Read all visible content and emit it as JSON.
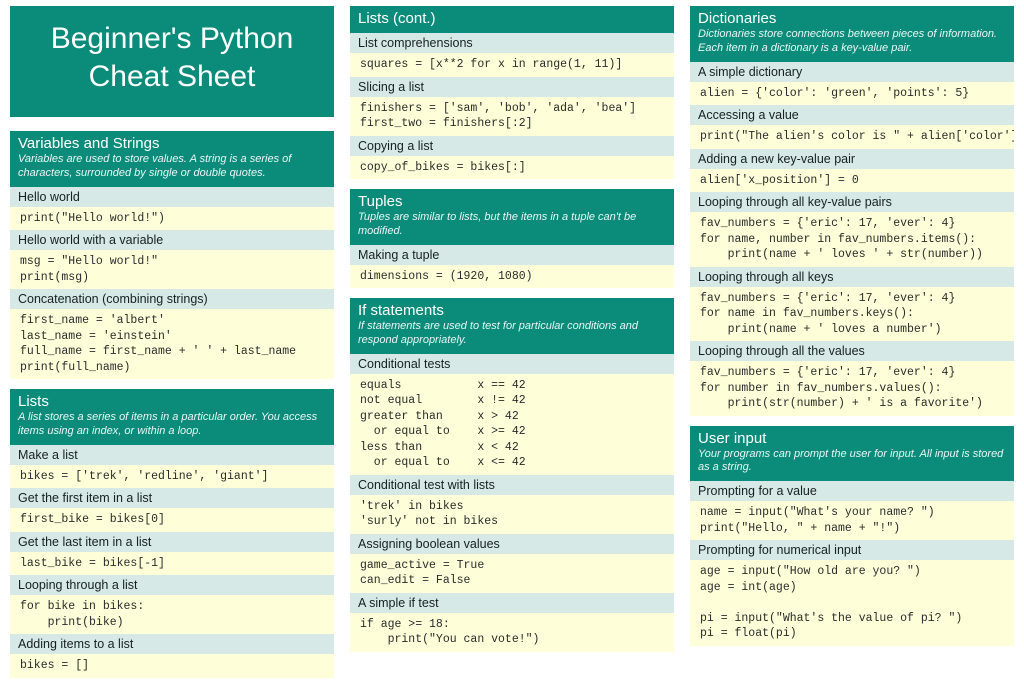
{
  "title": "Beginner's Python\nCheat Sheet",
  "columns": [
    [
      {
        "type": "title"
      },
      {
        "type": "head",
        "h": "Variables and Strings",
        "desc": "Variables are used to store values. A string is a series of characters, surrounded by single or double quotes."
      },
      {
        "type": "sub",
        "t": "Hello world"
      },
      {
        "type": "code",
        "t": "print(\"Hello world!\")"
      },
      {
        "type": "sub",
        "t": "Hello world with a variable"
      },
      {
        "type": "code",
        "t": "msg = \"Hello world!\"\nprint(msg)"
      },
      {
        "type": "sub",
        "t": "Concatenation (combining strings)"
      },
      {
        "type": "code",
        "t": "first_name = 'albert'\nlast_name = 'einstein'\nfull_name = first_name + ' ' + last_name\nprint(full_name)"
      },
      {
        "type": "head",
        "h": "Lists",
        "desc": "A list stores a series of items in a particular order. You access items using an index, or within a loop."
      },
      {
        "type": "sub",
        "t": "Make a list"
      },
      {
        "type": "code",
        "t": "bikes = ['trek', 'redline', 'giant']"
      },
      {
        "type": "sub",
        "t": "Get the first item in a list"
      },
      {
        "type": "code",
        "t": "first_bike = bikes[0]"
      },
      {
        "type": "sub",
        "t": "Get the last item in a list"
      },
      {
        "type": "code",
        "t": "last_bike = bikes[-1]"
      },
      {
        "type": "sub",
        "t": "Looping through a list"
      },
      {
        "type": "code",
        "t": "for bike in bikes:\n    print(bike)"
      },
      {
        "type": "sub",
        "t": "Adding items to a list"
      },
      {
        "type": "code",
        "t": "bikes = []"
      }
    ],
    [
      {
        "type": "head",
        "first": true,
        "h": "Lists (cont.)"
      },
      {
        "type": "sub",
        "t": "List comprehensions"
      },
      {
        "type": "code",
        "t": "squares = [x**2 for x in range(1, 11)]"
      },
      {
        "type": "sub",
        "t": "Slicing a list"
      },
      {
        "type": "code",
        "t": "finishers = ['sam', 'bob', 'ada', 'bea']\nfirst_two = finishers[:2]"
      },
      {
        "type": "sub",
        "t": "Copying a list"
      },
      {
        "type": "code",
        "t": "copy_of_bikes = bikes[:]"
      },
      {
        "type": "head",
        "h": "Tuples",
        "desc": "Tuples are similar to lists, but the items in a tuple can't be modified."
      },
      {
        "type": "sub",
        "t": "Making a tuple"
      },
      {
        "type": "code",
        "t": "dimensions = (1920, 1080)"
      },
      {
        "type": "head",
        "h": "If statements",
        "desc": "If statements are used to test for particular conditions and respond appropriately."
      },
      {
        "type": "sub",
        "t": "Conditional tests"
      },
      {
        "type": "code",
        "t": "equals           x == 42\nnot equal        x != 42\ngreater than     x > 42\n  or equal to    x >= 42\nless than        x < 42\n  or equal to    x <= 42"
      },
      {
        "type": "sub",
        "t": "Conditional test with lists"
      },
      {
        "type": "code",
        "t": "'trek' in bikes\n'surly' not in bikes"
      },
      {
        "type": "sub",
        "t": "Assigning boolean values"
      },
      {
        "type": "code",
        "t": "game_active = True\ncan_edit = False"
      },
      {
        "type": "sub",
        "t": "A simple if test"
      },
      {
        "type": "code",
        "t": "if age >= 18:\n    print(\"You can vote!\")"
      }
    ],
    [
      {
        "type": "head",
        "first": true,
        "h": "Dictionaries",
        "desc": "Dictionaries store connections between pieces of information. Each item in a dictionary is a key-value pair."
      },
      {
        "type": "sub",
        "t": "A simple dictionary"
      },
      {
        "type": "code",
        "t": "alien = {'color': 'green', 'points': 5}"
      },
      {
        "type": "sub",
        "t": "Accessing a value"
      },
      {
        "type": "code",
        "t": "print(\"The alien's color is \" + alien['color'])"
      },
      {
        "type": "sub",
        "t": "Adding a new key-value pair"
      },
      {
        "type": "code",
        "t": "alien['x_position'] = 0"
      },
      {
        "type": "sub",
        "t": "Looping through all key-value pairs"
      },
      {
        "type": "code",
        "t": "fav_numbers = {'eric': 17, 'ever': 4}\nfor name, number in fav_numbers.items():\n    print(name + ' loves ' + str(number))"
      },
      {
        "type": "sub",
        "t": "Looping through all keys"
      },
      {
        "type": "code",
        "t": "fav_numbers = {'eric': 17, 'ever': 4}\nfor name in fav_numbers.keys():\n    print(name + ' loves a number')"
      },
      {
        "type": "sub",
        "t": "Looping through all the values"
      },
      {
        "type": "code",
        "t": "fav_numbers = {'eric': 17, 'ever': 4}\nfor number in fav_numbers.values():\n    print(str(number) + ' is a favorite')"
      },
      {
        "type": "head",
        "h": "User input",
        "desc": "Your programs can prompt the user for input. All input is stored as a string."
      },
      {
        "type": "sub",
        "t": "Prompting for a value"
      },
      {
        "type": "code",
        "t": "name = input(\"What's your name? \")\nprint(\"Hello, \" + name + \"!\")"
      },
      {
        "type": "sub",
        "t": "Prompting for numerical input"
      },
      {
        "type": "code",
        "t": "age = input(\"How old are you? \")\nage = int(age)\n\npi = input(\"What's the value of pi? \")\npi = float(pi)"
      }
    ]
  ]
}
